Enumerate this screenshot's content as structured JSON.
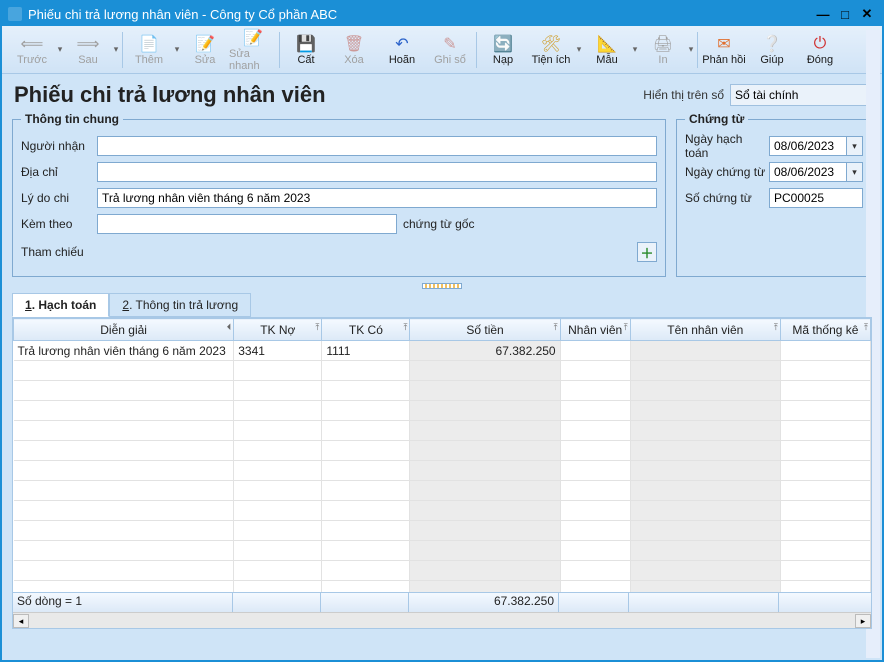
{
  "window": {
    "title": "Phiếu chi trả lương nhân viên - Công ty Cổ phần ABC"
  },
  "toolbar": {
    "truoc": "Trước",
    "sau": "Sau",
    "them": "Thêm",
    "sua": "Sửa",
    "suanhanh": "Sửa nhanh",
    "cat": "Cất",
    "xoa": "Xóa",
    "hoan": "Hoãn",
    "ghiso": "Ghi sổ",
    "nap": "Nạp",
    "tienich": "Tiện ích",
    "mau": "Mẫu",
    "in": "In",
    "phanhoi": "Phản hồi",
    "giup": "Giúp",
    "dong": "Đóng"
  },
  "page": {
    "title": "Phiếu chi trả lương nhân viên",
    "display_label": "Hiển thị trên sổ",
    "display_value": "Sổ tài chính"
  },
  "general": {
    "legend": "Thông tin chung",
    "recipient_label": "Người nhận",
    "recipient": "",
    "address_label": "Địa chỉ",
    "address": "",
    "reason_label": "Lý do chi",
    "reason": "Trả lương nhân viên tháng 6 năm 2023",
    "attach_label": "Kèm theo",
    "attach": "",
    "attach_suffix": "chứng từ gốc",
    "ref_label": "Tham chiếu"
  },
  "voucher": {
    "legend": "Chứng từ",
    "post_date_label": "Ngày hạch toán",
    "post_date": "08/06/2023",
    "voucher_date_label": "Ngày chứng từ",
    "voucher_date": "08/06/2023",
    "voucher_no_label": "Số chứng từ",
    "voucher_no": "PC00025"
  },
  "tabs": {
    "hachtoan_prefix": "1",
    "hachtoan": ". Hạch toán",
    "ttl_prefix": "2",
    "ttl": ". Thông tin trả lương"
  },
  "grid": {
    "headers": {
      "desc": "Diễn giải",
      "tkno": "TK Nợ",
      "tkco": "TK Có",
      "sotien": "Số tiền",
      "nhanvien": "Nhân viên",
      "tennv": "Tên nhân viên",
      "mathongke": "Mã thống kê"
    },
    "rows": [
      {
        "desc": "Trả lương nhân viên tháng 6 năm 2023",
        "tkno": "3341",
        "tkco": "1111",
        "sotien": "67.382.250",
        "nhanvien": "",
        "tennv": "",
        "mathongke": ""
      }
    ],
    "footer": {
      "count_label": "Số dòng = 1",
      "sum_sotien": "67.382.250"
    }
  }
}
